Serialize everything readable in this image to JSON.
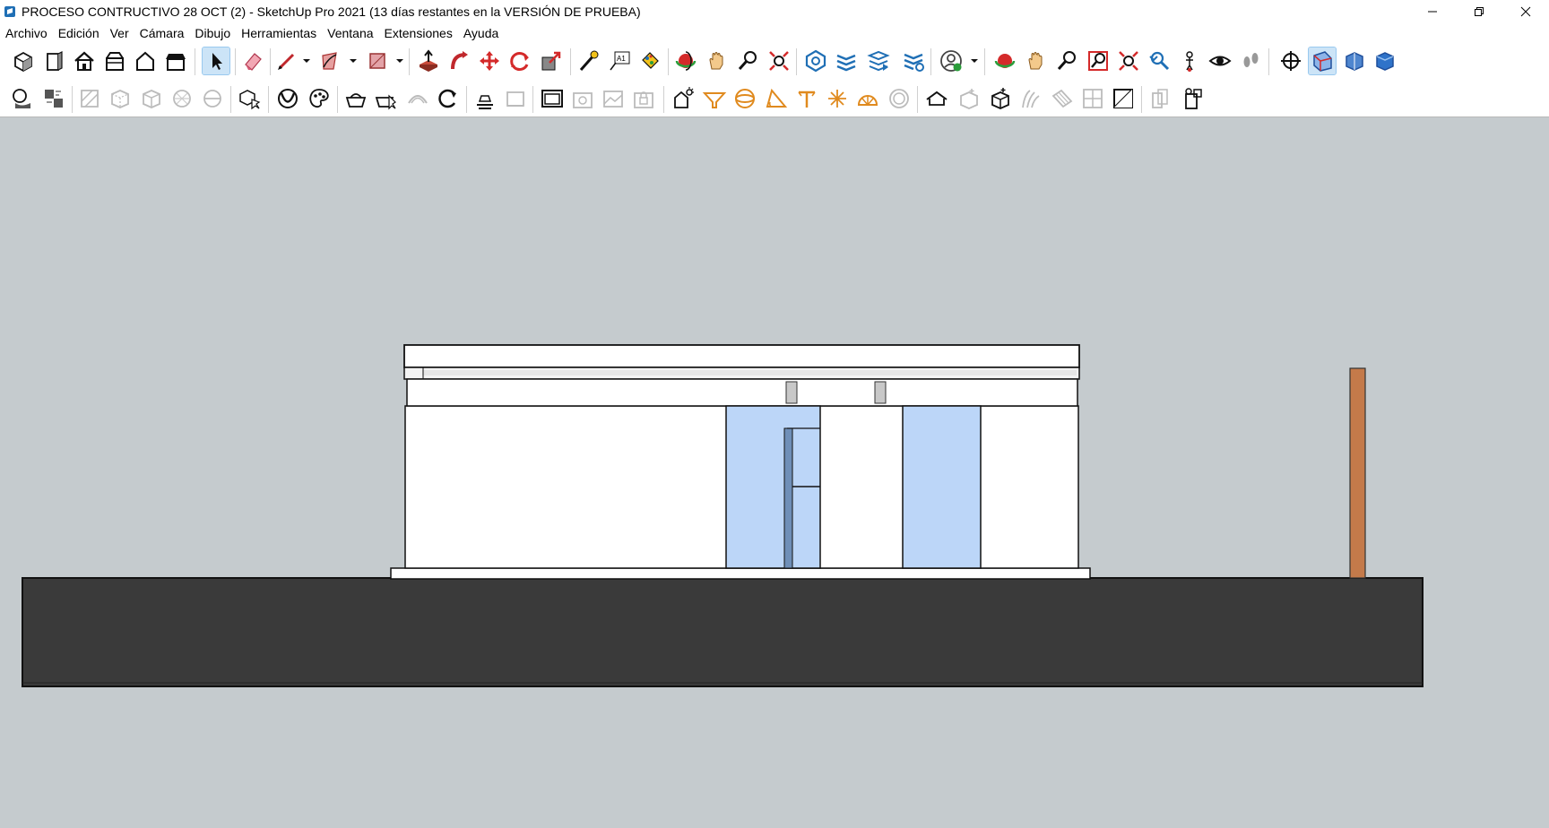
{
  "window": {
    "title": "PROCESO CONTRUCTIVO 28 OCT (2) - SketchUp Pro 2021 (13 días restantes en la VERSIÓN DE PRUEBA)",
    "controls": [
      "minimize-icon",
      "restore-icon",
      "close-icon"
    ]
  },
  "menu": {
    "items": [
      "Archivo",
      "Edición",
      "Ver",
      "Cámara",
      "Dibujo",
      "Herramientas",
      "Ventana",
      "Extensiones",
      "Ayuda"
    ]
  },
  "toolbar_top": {
    "tools": [
      "iso-view-icon",
      "front-view-icon",
      "house-icon",
      "open-box-icon",
      "home-outline-icon",
      "box-top-icon",
      "select-arrow-icon",
      "eraser-icon",
      "pencil-line-icon",
      "rectangle-icon",
      "push-pull-icon",
      "follow-me-icon",
      "move-icon",
      "rotate-icon",
      "scale-icon",
      "tape-measure-icon",
      "text-icon",
      "paint-bucket-icon",
      "orbit-icon",
      "pan-hand-icon",
      "zoom-icon",
      "zoom-extents-icon",
      "warehouse-icon",
      "layers-icon",
      "extension-warehouse-icon",
      "extension-manager-icon",
      "user-account-icon",
      "orbit-alt-icon",
      "pan-alt-icon",
      "zoom-alt-icon",
      "zoom-window-icon",
      "zoom-extents-alt-icon",
      "previous-view-icon",
      "position-camera-icon",
      "look-around-icon",
      "walk-icon",
      "axes-icon",
      "section-plane-icon",
      "section-cut-icon",
      "section-fill-icon"
    ],
    "active": [
      "select-arrow-icon",
      "section-plane-icon"
    ],
    "colors": {
      "primary": "#1a1a1a",
      "accent_red": "#d92a2a",
      "accent_blue": "#1f6fb5",
      "accent_orange": "#e08a1e"
    }
  },
  "toolbar_bottom": {
    "tools": [
      "shadows-icon",
      "fog-icon",
      "xray-icon",
      "back-edges-icon",
      "wireframe-icon",
      "hidden-line-icon",
      "shaded-icon",
      "shaded-textures-icon",
      "monochrome-icon",
      "make-component-icon",
      "styles-icon",
      "materials-icon",
      "sandbox-smoove-icon",
      "sandbox-stamp-icon",
      "sandbox-drape-icon",
      "sandbox-add-detail-icon",
      "sandbox-flip-edge-icon",
      "dynamic-component-icon",
      "dynamic-interact-icon",
      "dynamic-options-icon",
      "scene-tab-icon",
      "scene-update-icon",
      "photo-match-icon",
      "photo-match-edit-icon",
      "solar-north-icon",
      "sun-settings-icon",
      "circle-tool-icon",
      "protractor-icon",
      "dimension-icon",
      "axes-tool-icon",
      "section-orange-icon",
      "sphere-icon",
      "sketchfab-icon",
      "unlock-box-icon",
      "lock-box-icon",
      "sandbox-from-contours-icon",
      "sandbox-from-scratch-icon",
      "outer-shell-icon",
      "intersect-icon",
      "split-icon",
      "trim-icon"
    ]
  },
  "viewport": {
    "background": "#c5cbce",
    "ground_color": "#3a3a3a",
    "glass_color": "#bcd6f8",
    "post_color": "#c47a4a"
  }
}
